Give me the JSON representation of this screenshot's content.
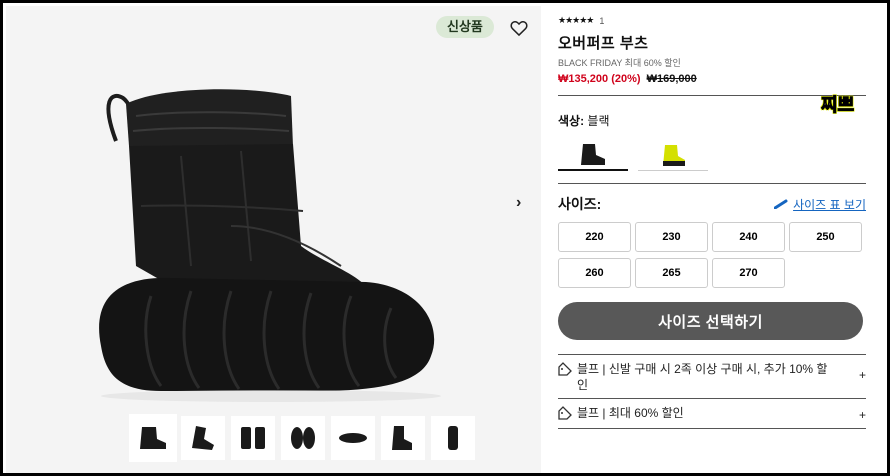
{
  "gallery": {
    "badge": "신상품",
    "thumbnails": [
      "side-view",
      "three-quarter-view",
      "pair-front",
      "pair-top",
      "sole-view",
      "side-pair",
      "back-view"
    ]
  },
  "product": {
    "rating_stars": "★★★★★",
    "rating_count": "1",
    "title": "오버퍼프 부츠",
    "subtitle": "BLACK FRIDAY 최대 60% 할인",
    "price_sale": "₩135,200 (20%)",
    "price_original": "₩169,000",
    "sticker": "찌쁘"
  },
  "color": {
    "label": "색상:",
    "value": "블랙",
    "swatches": [
      {
        "name": "black",
        "hex": "#1a1a1a"
      },
      {
        "name": "lime",
        "hex": "#d4e000"
      }
    ]
  },
  "size": {
    "label": "사이즈:",
    "guide": "사이즈 표 보기",
    "options": [
      "220",
      "230",
      "240",
      "250",
      "260",
      "265",
      "270"
    ]
  },
  "cta": "사이즈 선택하기",
  "promos": [
    {
      "text": "블프 | 신발 구매 시 2족 이상 구매 시, 추가 10% 할인",
      "toggle": "+"
    },
    {
      "text": "블프 | 최대 60% 할인",
      "toggle": "+"
    }
  ],
  "colors": {
    "sale": "#d0021b",
    "cta": "#585858",
    "badge_bg": "#dbe9d6",
    "link": "#1565c0"
  }
}
